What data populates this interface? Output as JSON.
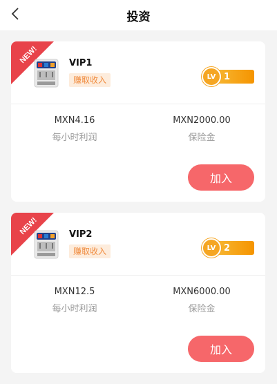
{
  "header": {
    "title": "投资",
    "back_icon": "chevron-left-icon"
  },
  "colors": {
    "accent": "#f6676a",
    "badge_red": "#e8434a",
    "level_orange": "#f5a623",
    "tag_bg": "#fdecdc",
    "tag_text": "#f08a3c"
  },
  "cards": [
    {
      "badge": "NEW!",
      "name": "VIP1",
      "tag": "赚取收入",
      "level": "1",
      "level_prefix": "LV",
      "hourly_profit_value": "MXN4.16",
      "hourly_profit_label": "每小时利润",
      "deposit_value": "MXN2000.00",
      "deposit_label": "保险金",
      "join_label": "加入"
    },
    {
      "badge": "NEW!",
      "name": "VIP2",
      "tag": "赚取收入",
      "level": "2",
      "level_prefix": "LV",
      "hourly_profit_value": "MXN12.5",
      "hourly_profit_label": "每小时利润",
      "deposit_value": "MXN6000.00",
      "deposit_label": "保险金",
      "join_label": "加入"
    }
  ]
}
